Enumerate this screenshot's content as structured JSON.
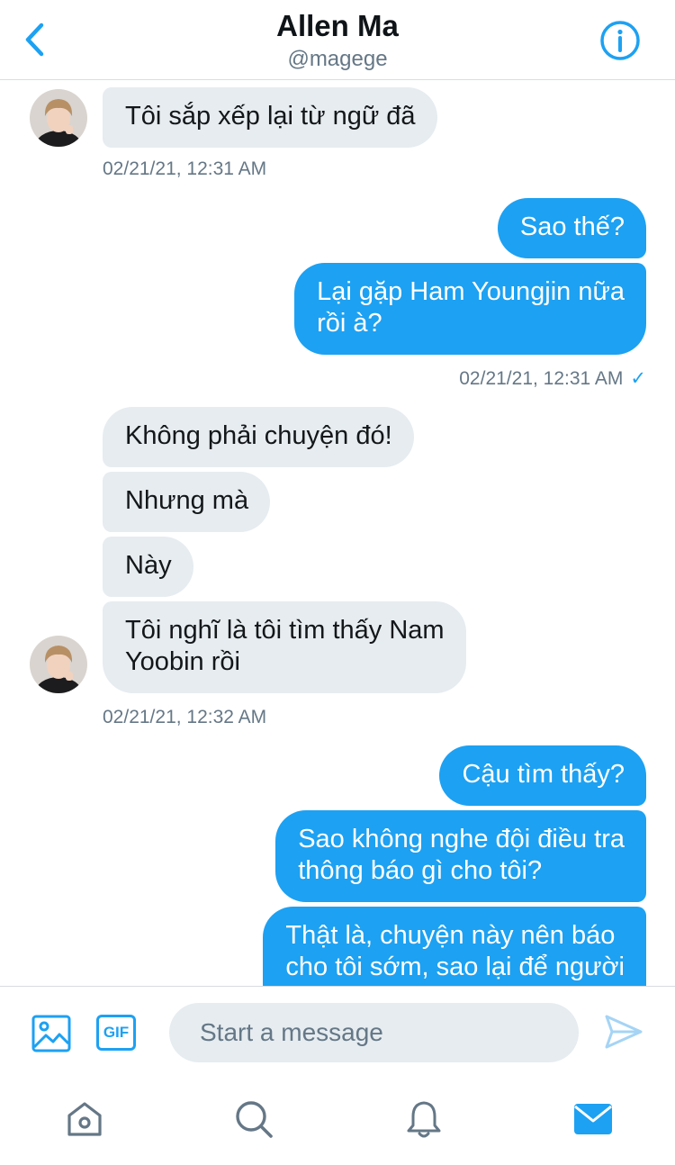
{
  "header": {
    "title": "Allen Ma",
    "handle": "@magege"
  },
  "messages": [
    {
      "text": "Tôi sắp xếp lại từ ngữ đã"
    },
    {
      "text": "02/21/21, 12:31 AM"
    },
    {
      "text": "Sao thế?"
    },
    {
      "line1": "Lại gặp Ham Youngjin nữa",
      "line2": "rồi à?"
    },
    {
      "text": "02/21/21, 12:31 AM",
      "check": "✓"
    },
    {
      "text": "Không phải chuyện đó!"
    },
    {
      "text": "Nhưng mà"
    },
    {
      "text": "Này"
    },
    {
      "line1": "Tôi nghĩ là tôi tìm thấy Nam",
      "line2": "Yoobin rồi"
    },
    {
      "text": "02/21/21, 12:32 AM"
    },
    {
      "text": "Cậu tìm thấy?"
    },
    {
      "line1": "Sao không nghe đội điều tra",
      "line2": "thông báo gì cho tôi?"
    },
    {
      "line1": "Thật là, chuyện này nên báo",
      "line2": "cho tôi sớm, sao lại để người"
    }
  ],
  "composer": {
    "placeholder": "Start a message",
    "gif_label": "GIF"
  },
  "icons": {
    "back": "chevron-left-icon",
    "info": "info-icon",
    "media": "image-icon",
    "gif": "gif-icon",
    "send": "send-icon",
    "home": "home-icon",
    "search": "search-icon",
    "notifications": "bell-icon",
    "messages": "mail-icon"
  },
  "colors": {
    "accent": "#1da1f2",
    "incoming_bubble": "#e6ecf0",
    "muted_text": "#657786",
    "icon_gray": "#657786"
  }
}
